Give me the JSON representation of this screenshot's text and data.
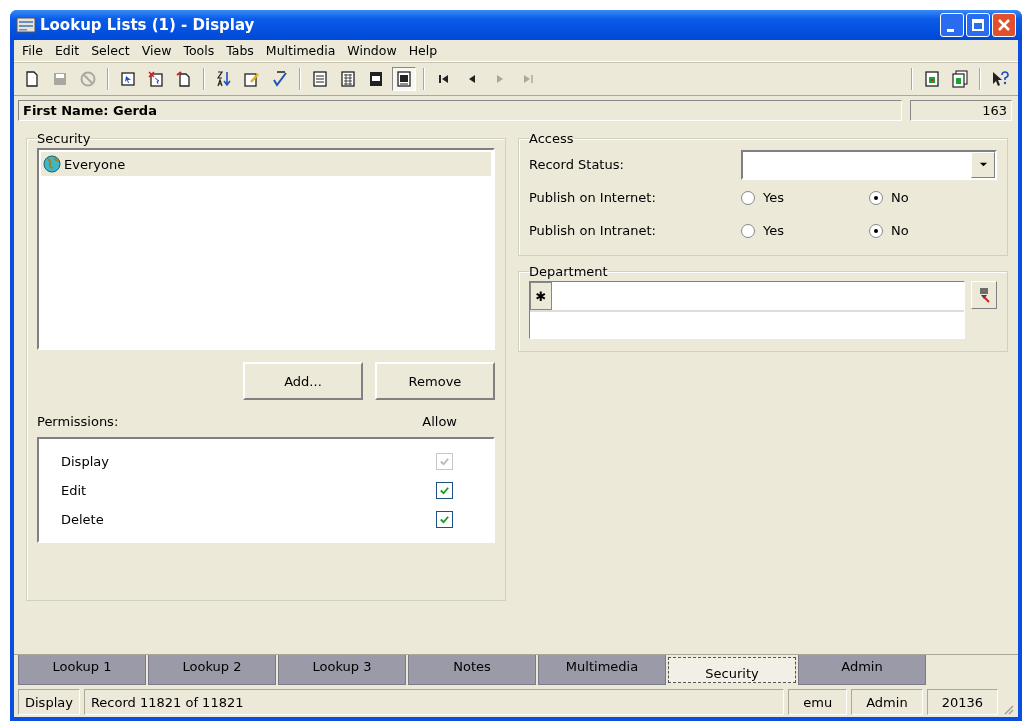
{
  "window": {
    "title": "Lookup Lists (1) - Display"
  },
  "menu": [
    "File",
    "Edit",
    "Select",
    "View",
    "Tools",
    "Tabs",
    "Multimedia",
    "Window",
    "Help"
  ],
  "toolbar": [
    [
      {
        "kind": "new",
        "disabled": false,
        "pressed": false
      },
      {
        "kind": "save",
        "disabled": true,
        "pressed": false
      },
      {
        "kind": "cancel",
        "disabled": true,
        "pressed": false
      }
    ],
    [
      {
        "kind": "doc-arrow",
        "disabled": false,
        "pressed": false
      },
      {
        "kind": "doc-delete",
        "disabled": false,
        "pressed": false
      },
      {
        "kind": "doc-add",
        "disabled": false,
        "pressed": false
      }
    ],
    [
      {
        "kind": "sort",
        "disabled": false,
        "pressed": false
      },
      {
        "kind": "edit",
        "disabled": false,
        "pressed": false
      },
      {
        "kind": "spell",
        "disabled": false,
        "pressed": false
      }
    ],
    [
      {
        "kind": "view-list",
        "disabled": false,
        "pressed": false
      },
      {
        "kind": "view-grid",
        "disabled": false,
        "pressed": false
      },
      {
        "kind": "view-page",
        "disabled": false,
        "pressed": false
      },
      {
        "kind": "view-image",
        "disabled": false,
        "pressed": true
      }
    ],
    [
      {
        "kind": "first",
        "disabled": false,
        "pressed": false
      },
      {
        "kind": "prev",
        "disabled": false,
        "pressed": false
      },
      {
        "kind": "next",
        "disabled": true,
        "pressed": false
      },
      {
        "kind": "last",
        "disabled": true,
        "pressed": false
      }
    ],
    [
      {
        "kind": "doc-import",
        "disabled": false,
        "pressed": false
      },
      {
        "kind": "docs-import",
        "disabled": false,
        "pressed": false
      }
    ],
    [
      {
        "kind": "help",
        "disabled": false,
        "pressed": false
      }
    ]
  ],
  "record_bar": {
    "label": "First Name: Gerda",
    "count": "163"
  },
  "security": {
    "title": "Security",
    "items": [
      {
        "label": "Everyone",
        "selected": true
      }
    ],
    "buttons": [
      "Add...",
      "Remove"
    ],
    "permissions_label": "Permissions:",
    "allow_label": "Allow",
    "permissions": [
      {
        "label": "Display",
        "checked": true,
        "disabled": true
      },
      {
        "label": "Edit",
        "checked": true,
        "disabled": false
      },
      {
        "label": "Delete",
        "checked": true,
        "disabled": false
      }
    ]
  },
  "access": {
    "title": "Access",
    "record_status": {
      "label": "Record Status:"
    },
    "rows": [
      {
        "label": "Publish on Internet:",
        "options": [
          {
            "label": "Yes",
            "selected": false
          },
          {
            "label": "No",
            "selected": true
          }
        ]
      },
      {
        "label": "Publish on Intranet:",
        "options": [
          {
            "label": "Yes",
            "selected": false
          },
          {
            "label": "No",
            "selected": true
          }
        ]
      }
    ]
  },
  "department": {
    "title": "Department",
    "row_marker": "✱"
  },
  "tabs": [
    {
      "label": "Lookup 1",
      "selected": false
    },
    {
      "label": "Lookup 2",
      "selected": false
    },
    {
      "label": "Lookup 3",
      "selected": false
    },
    {
      "label": "Notes",
      "selected": false
    },
    {
      "label": "Multimedia",
      "selected": false
    },
    {
      "label": "Security",
      "selected": true
    },
    {
      "label": "Admin",
      "selected": false
    }
  ],
  "status_bar": [
    "Display",
    "Record 11821 of 11821",
    "emu",
    "Admin",
    "20136"
  ]
}
